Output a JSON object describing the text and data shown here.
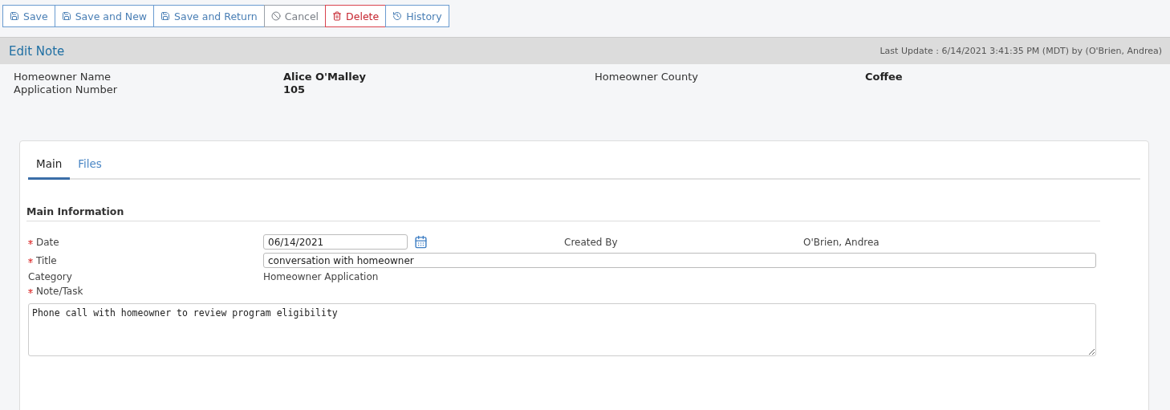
{
  "toolbar": [
    {
      "label": "Save",
      "kind": "save"
    },
    {
      "label": "Save and New",
      "kind": "save"
    },
    {
      "label": "Save and Return",
      "kind": "save"
    },
    {
      "label": "Cancel",
      "kind": "cancel"
    },
    {
      "label": "Delete",
      "kind": "delete"
    },
    {
      "label": "History",
      "kind": "history"
    }
  ],
  "header": {
    "title": "Edit Note",
    "last_update": "Last Update : 6/14/2021 3:41:35 PM (MDT) by (O'Brien, Andrea)"
  },
  "summary": [
    {
      "label": "Homeowner Name",
      "value": "Alice O'Malley"
    },
    {
      "label": "Homeowner County",
      "value": "Coffee"
    },
    {
      "label": "Application Number",
      "value": "105"
    }
  ],
  "tabs": [
    {
      "label": "Main",
      "selected": true
    },
    {
      "label": "Files",
      "selected": false
    }
  ],
  "section": {
    "title": "Main Information"
  },
  "fields": {
    "date": {
      "label": "Date",
      "required": true,
      "value": "06/14/2021"
    },
    "created_by": {
      "label": "Created By",
      "value": "O'Brien, Andrea"
    },
    "title": {
      "label": "Title",
      "required": true,
      "value": "conversation with homeowner"
    },
    "category": {
      "label": "Category",
      "value": "Homeowner Application"
    },
    "note": {
      "label": "Note/Task",
      "required": true,
      "value": "Phone call with homeowner to review program eligibility"
    }
  }
}
